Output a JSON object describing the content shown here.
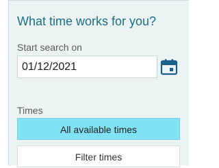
{
  "panel": {
    "title": "What time works for you?"
  },
  "start_search": {
    "label": "Start search on",
    "value": "01/12/2021",
    "calendar_icon": "calendar-icon"
  },
  "times": {
    "label": "Times",
    "options": [
      {
        "label": "All available times",
        "selected": true
      },
      {
        "label": "Filter times",
        "selected": false
      }
    ]
  },
  "colors": {
    "title": "#1b6f86",
    "selected_option": "#7fe3f5",
    "panel_bg": "#ebf3f3",
    "icon": "#1b5f8a"
  }
}
